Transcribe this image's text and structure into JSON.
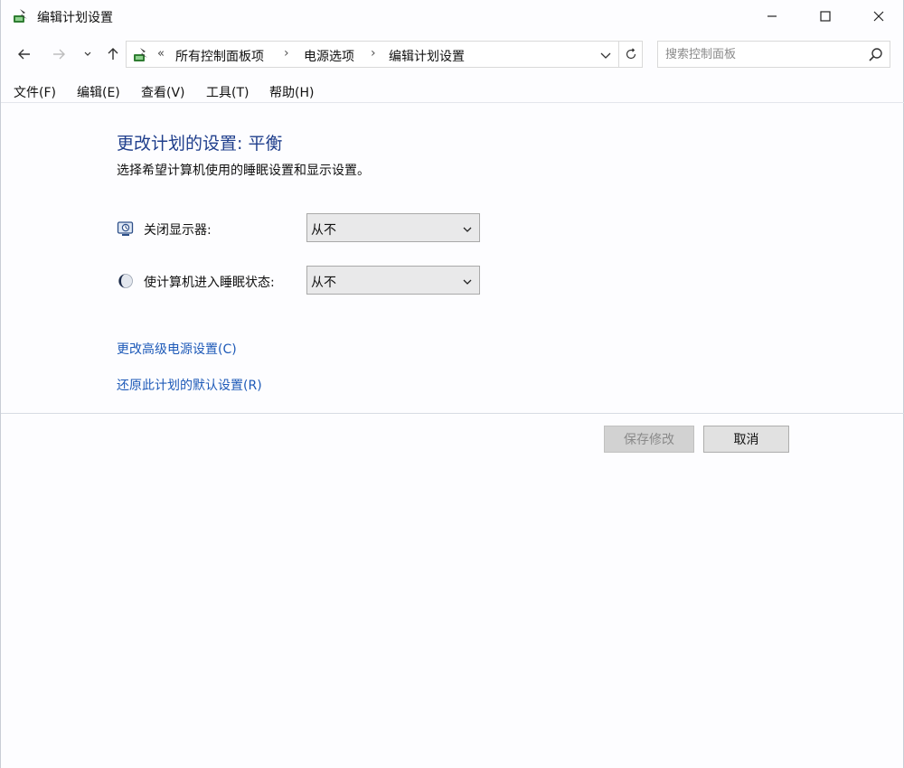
{
  "window": {
    "title": "编辑计划设置",
    "controls": {
      "minimize": "minimize",
      "maximize": "maximize",
      "close": "close"
    }
  },
  "navigation": {
    "address_overflow": "«",
    "breadcrumbs": [
      "所有控制面板项",
      "电源选项",
      "编辑计划设置"
    ],
    "separator": "›",
    "search_placeholder": "搜索控制面板"
  },
  "menu": {
    "items": [
      "文件(F)",
      "编辑(E)",
      "查看(V)",
      "工具(T)",
      "帮助(H)"
    ]
  },
  "main": {
    "title": "更改计划的设置: 平衡",
    "description": "选择希望计算机使用的睡眠设置和显示设置。",
    "settings": [
      {
        "label": "关闭显示器:",
        "value": "从不",
        "icon": "monitor-icon"
      },
      {
        "label": "使计算机进入睡眠状态:",
        "value": "从不",
        "icon": "moon-icon"
      }
    ],
    "links": [
      "更改高级电源设置(C)",
      "还原此计划的默认设置(R)"
    ]
  },
  "footer": {
    "save_label": "保存修改",
    "cancel_label": "取消",
    "save_enabled": false
  },
  "colors": {
    "title": "#1f3e8c",
    "link": "#1e5ab8",
    "background": "#fdfdff"
  }
}
